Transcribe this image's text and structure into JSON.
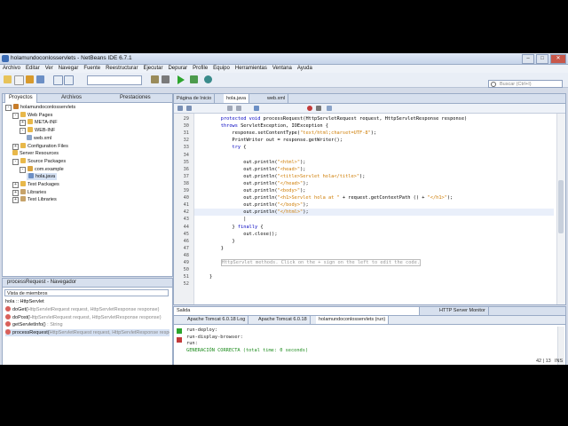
{
  "window": {
    "title": "holamundoconlosservlets - NetBeans IDE 6.7.1",
    "min": "–",
    "max": "□",
    "close": "✕"
  },
  "menu": [
    "Archivo",
    "Editar",
    "Ver",
    "Navegar",
    "Fuente",
    "Reestructurar",
    "Ejecutar",
    "Depurar",
    "Profile",
    "Equipo",
    "Herramientas",
    "Ventana",
    "Ayuda"
  ],
  "search": {
    "placeholder": "Buscar (Ctrl+I)"
  },
  "left_tabs": [
    "Proyectos",
    "Archivos",
    "Prestaciones"
  ],
  "tree": [
    {
      "label": "holamundoconlosservlets",
      "indent": 0,
      "icon": "project-icon",
      "color": "#c77d2a",
      "toggle": "-"
    },
    {
      "label": "Web Pages",
      "indent": 1,
      "icon": "folder-icon",
      "color": "#e8b84a",
      "toggle": "-"
    },
    {
      "label": "META-INF",
      "indent": 2,
      "icon": "folder-icon",
      "color": "#e8b84a",
      "toggle": "+"
    },
    {
      "label": "WEB-INF",
      "indent": 2,
      "icon": "folder-icon",
      "color": "#e8b84a",
      "toggle": "-"
    },
    {
      "label": "web.xml",
      "indent": 3,
      "icon": "xml-file-icon",
      "color": "#8aa3c8",
      "toggle": ""
    },
    {
      "label": "Configuration Files",
      "indent": 1,
      "icon": "folder-icon",
      "color": "#e8b84a",
      "toggle": "+"
    },
    {
      "label": "Server Resources",
      "indent": 1,
      "icon": "folder-icon",
      "color": "#e8b84a",
      "toggle": ""
    },
    {
      "label": "Source Packages",
      "indent": 1,
      "icon": "folder-icon",
      "color": "#e8b84a",
      "toggle": "-"
    },
    {
      "label": "com.example",
      "indent": 2,
      "icon": "package-icon",
      "color": "#d9a441",
      "toggle": "-"
    },
    {
      "label": "hola.java",
      "indent": 3,
      "icon": "java-file-icon",
      "color": "#6c8fc5",
      "toggle": "",
      "selected": true
    },
    {
      "label": "Test Packages",
      "indent": 1,
      "icon": "folder-icon",
      "color": "#e8b84a",
      "toggle": "+"
    },
    {
      "label": "Libraries",
      "indent": 1,
      "icon": "library-icon",
      "color": "#c7a36a",
      "toggle": "+"
    },
    {
      "label": "Test Libraries",
      "indent": 1,
      "icon": "library-icon",
      "color": "#c7a36a",
      "toggle": "+"
    }
  ],
  "navigator": {
    "title": "processRequest - Navegador",
    "view": "Vista de miembros",
    "root": "hola :: HttpServlet",
    "items": [
      {
        "name": "doGet(",
        "params": "HttpServletRequest request, HttpServletResponse response)"
      },
      {
        "name": "doPost(",
        "params": "HttpServletRequest request, HttpServletResponse response)"
      },
      {
        "name": "getServletInfo()",
        "params": " : String"
      },
      {
        "name": "processRequest(",
        "params": "HttpServletRequest request, HttpServletResponse response)",
        "selected": true
      }
    ]
  },
  "editor": {
    "tabs": [
      {
        "label": "Página de Inicio",
        "active": false
      },
      {
        "label": "hola.java",
        "active": true
      },
      {
        "label": "web.xml",
        "active": false
      }
    ],
    "lines": [
      {
        "n": "29",
        "html": "    <span class=\"kw\">protected void</span> processRequest(HttpServletRequest request, HttpServletResponse response)"
      },
      {
        "n": "30",
        "html": "    <span class=\"kw\">throws</span> ServletException, IOException {"
      },
      {
        "n": "31",
        "html": "        response.setContentType(<span class=\"str\">\"text/html;charset=UTF-8\"</span>);"
      },
      {
        "n": "32",
        "html": "        PrintWriter out = response.getWriter();"
      },
      {
        "n": "33",
        "html": "        <span class=\"kw\">try</span> {"
      },
      {
        "n": "34",
        "html": ""
      },
      {
        "n": "35",
        "html": "            out.println(<span class=\"str\">\"&lt;html&gt;\"</span>);"
      },
      {
        "n": "36",
        "html": "            out.println(<span class=\"str\">\"&lt;head&gt;\"</span>);"
      },
      {
        "n": "37",
        "html": "            out.println(<span class=\"str\">\"&lt;title&gt;Servlet hola&lt;/title&gt;\"</span>);"
      },
      {
        "n": "38",
        "html": "            out.println(<span class=\"str\">\"&lt;/head&gt;\"</span>);"
      },
      {
        "n": "39",
        "html": "            out.println(<span class=\"str\">\"&lt;body&gt;\"</span>);"
      },
      {
        "n": "40",
        "html": "            out.println(<span class=\"str\">\"&lt;h1&gt;Servlet hola at \"</span> + request.getContextPath () + <span class=\"str\">\"&lt;/h1&gt;\"</span>);"
      },
      {
        "n": "41",
        "html": "            out.println(<span class=\"str\">\"&lt;/body&gt;\"</span>);"
      },
      {
        "n": "42",
        "html": "            out.println(<span class=\"str\">\"&lt;/html&gt;\"</span>);"
      },
      {
        "n": "43",
        "html": "            |"
      },
      {
        "n": "44",
        "html": "        } <span class=\"kw\">finally</span> {"
      },
      {
        "n": "45",
        "html": "            out.close();"
      },
      {
        "n": "46",
        "html": "        }"
      },
      {
        "n": "47",
        "html": "    }"
      },
      {
        "n": "48",
        "html": ""
      },
      {
        "n": "49",
        "html": "    <span class=\"cm\" style=\"border:1px solid #bbb;\">HttpServlet methods. Click on the + sign on the left to edit the code.</span>"
      },
      {
        "n": "50",
        "html": ""
      },
      {
        "n": "51",
        "html": "}"
      },
      {
        "n": "52",
        "html": ""
      }
    ]
  },
  "output": {
    "header_left": "Salida",
    "header_right": "HTTP Server Monitor",
    "tabs": [
      {
        "label": "Apache Tomcat 6.0.18 Log",
        "active": false
      },
      {
        "label": "Apache Tomcat 6.0.18",
        "active": false
      },
      {
        "label": "holamundoconlosservlets (run)",
        "active": true
      }
    ],
    "lines": [
      {
        "text": "run-deploy:",
        "color": "#222"
      },
      {
        "text": "run-display-browser:",
        "color": "#222"
      },
      {
        "text": "run:",
        "color": "#222"
      },
      {
        "text": "GENERACIÓN CORRECTA (total time: 0 seconds)",
        "color": "#1a8a1a"
      }
    ]
  },
  "status": {
    "position": "42 | 13",
    "mode": "INS"
  }
}
